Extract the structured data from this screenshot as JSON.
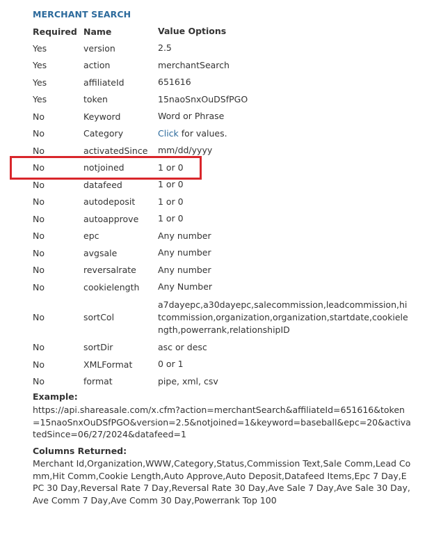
{
  "section_title": "MERCHANT SEARCH",
  "headers": {
    "required": "Required",
    "name": "Name",
    "value_options": "Value Options"
  },
  "rows": [
    {
      "required": "Yes",
      "name": "version",
      "value": "2.5"
    },
    {
      "required": "Yes",
      "name": "action",
      "value": "merchantSearch"
    },
    {
      "required": "Yes",
      "name": "affiliateId",
      "value": "651616"
    },
    {
      "required": "Yes",
      "name": "token",
      "value": "15naoSnxOuDSfPGO"
    },
    {
      "required": "No",
      "name": "Keyword",
      "value": "Word or Phrase"
    },
    {
      "required": "No",
      "name": "Category",
      "value_link": "Click",
      "value_suffix": " for values."
    },
    {
      "required": "No",
      "name": "activatedSince",
      "value": "mm/dd/yyyy"
    },
    {
      "required": "No",
      "name": "notjoined",
      "value": "1 or 0"
    },
    {
      "required": "No",
      "name": "datafeed",
      "value": "1 or 0"
    },
    {
      "required": "No",
      "name": "autodeposit",
      "value": "1 or 0"
    },
    {
      "required": "No",
      "name": "autoapprove",
      "value": "1 or 0"
    },
    {
      "required": "No",
      "name": "epc",
      "value": "Any number"
    },
    {
      "required": "No",
      "name": "avgsale",
      "value": "Any number"
    },
    {
      "required": "No",
      "name": "reversalrate",
      "value": "Any number"
    },
    {
      "required": "No",
      "name": "cookielength",
      "value": "Any Number"
    },
    {
      "required": "No",
      "name": "sortCol",
      "value": "a7dayepc,a30dayepc,salecommission,leadcommission,hitcommission,organization,organization,startdate,cookielength,powerrank,relationshipID"
    },
    {
      "required": "No",
      "name": "sortDir",
      "value": "asc or desc"
    },
    {
      "required": "No",
      "name": "XMLFormat",
      "value": "0 or 1"
    },
    {
      "required": "No",
      "name": "format",
      "value": "pipe, xml, csv"
    }
  ],
  "example_label": "Example:",
  "example_url": "https://api.shareasale.com/x.cfm?action=merchantSearch&affiliateId=651616&token=15naoSnxOuDSfPGO&version=2.5&notjoined=1&keyword=baseball&epc=20&activatedSince=06/27/2024&datafeed=1",
  "columns_label": "Columns Returned:",
  "columns_text": "Merchant Id,Organization,WWW,Category,Status,Commission Text,Sale Comm,Lead Comm,Hit Comm,Cookie Length,Auto Approve,Auto Deposit,Datafeed Items,Epc 7 Day,EPC 30 Day,Reversal Rate 7 Day,Reversal Rate 30 Day,Ave Sale 7 Day,Ave Sale 30 Day,Ave Comm 7 Day,Ave Comm 30 Day,Powerrank Top 100",
  "highlight_color": "#d9262b",
  "link_color": "#2c6a9c"
}
